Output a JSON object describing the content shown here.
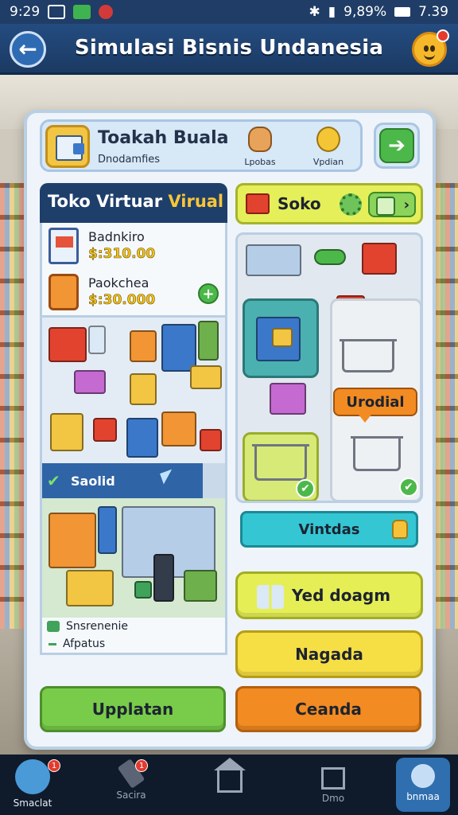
{
  "status_bar": {
    "time": "9:29",
    "battery_text": "9,89%",
    "clock_right": "7.39"
  },
  "app_bar": {
    "title": "Simulasi Bisnis Undanesia",
    "back_icon": "arrow-left-icon",
    "mascot_icon": "mascot-face-icon"
  },
  "store_panel": {
    "name": "Toakah Buala",
    "subtitle": "Dnodamfies",
    "stat_1_label": "Lpobas",
    "stat_2_label": "Vpdian"
  },
  "left_column": {
    "header_main": "Toko Virtuar ",
    "header_accent": "Virual",
    "products": [
      {
        "name": "Badnkiro",
        "price": "$:310.00"
      },
      {
        "name": "Paokchea",
        "price": "$:30.000"
      }
    ],
    "strip_label": "Saolid",
    "info_1": "Snsrenenie",
    "info_2": "Afpatus"
  },
  "right_column": {
    "header_label": "Soko",
    "badge_label": "Urodial",
    "teal_button": "Vintdas",
    "button_lime": "Yed doagm",
    "button_sun": "Nagada"
  },
  "bottom_buttons": {
    "green": "Upplatan",
    "orange": "Ceanda"
  },
  "bottom_nav": [
    {
      "label": "Smaclat",
      "badge": "1"
    },
    {
      "label": "Sacira",
      "badge": "1"
    },
    {
      "label": ""
    },
    {
      "label": "Dmo"
    },
    {
      "label": "bnmaa"
    }
  ],
  "colors": {
    "primary_dark": "#1f3f6b",
    "accent_yellow": "#f6c638",
    "green": "#78cc4a",
    "orange": "#f28b22",
    "teal": "#35c6d4"
  }
}
